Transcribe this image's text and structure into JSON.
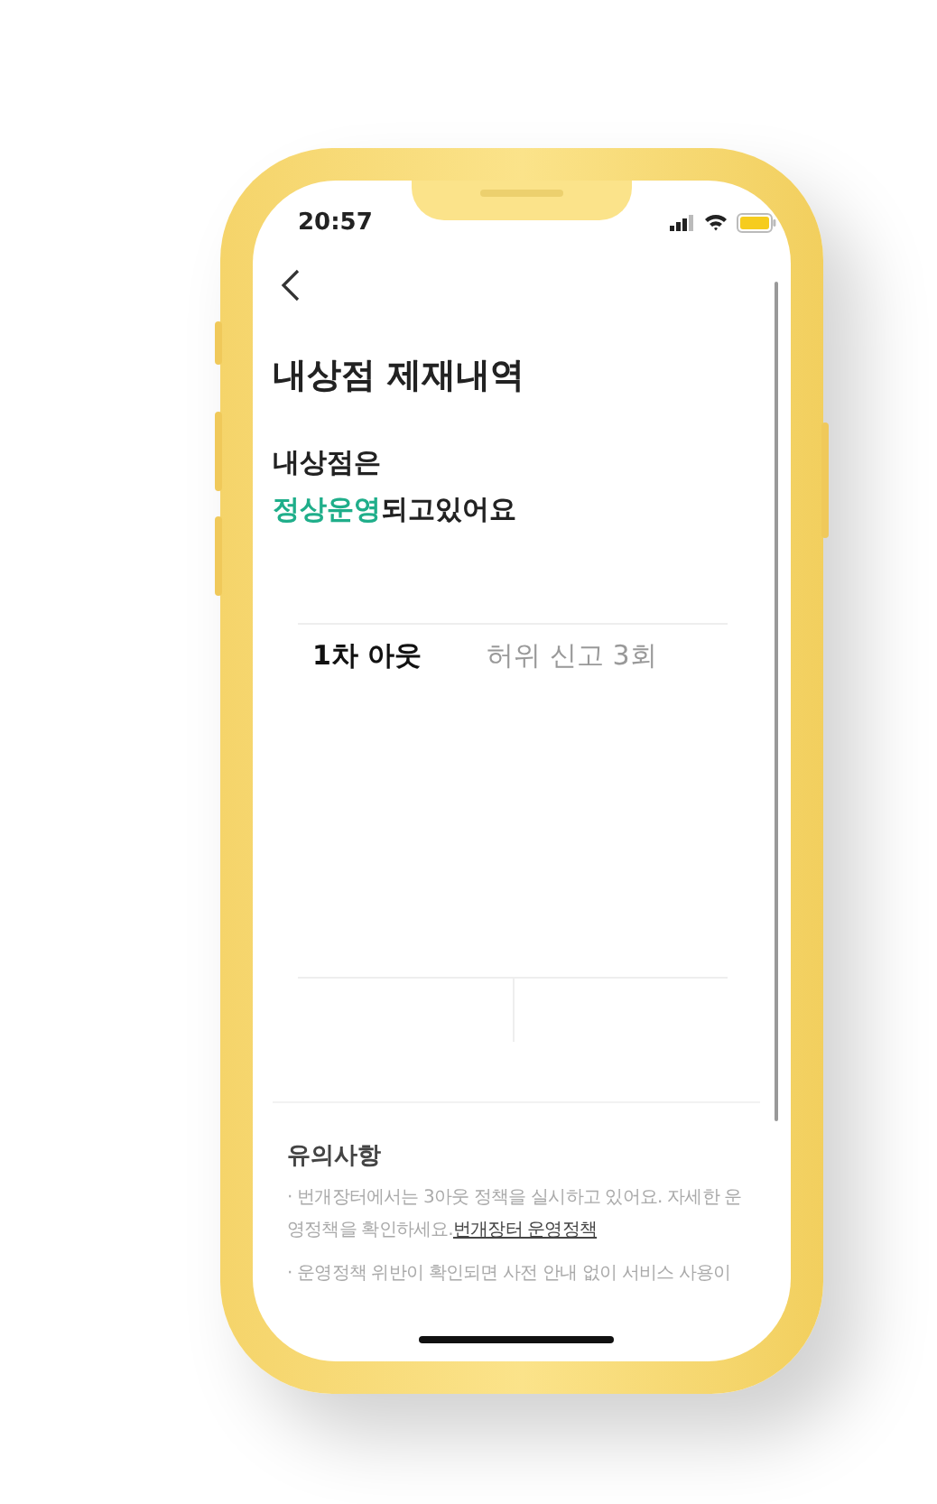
{
  "status_bar": {
    "time": "20:57"
  },
  "title": "내상점 제재내역",
  "status": {
    "line1": "내상점은",
    "highlight": "정상운영",
    "rest": "되고있어요"
  },
  "tabs": [
    {
      "label": "1차 아웃",
      "selected": true
    },
    {
      "label": "허위 신고 3회",
      "selected": false
    }
  ],
  "notice": {
    "heading": "유의사항",
    "items": [
      {
        "text": "· 번개장터에서는 3아웃 정책을 실시하고 있어요. 자세한 운영정책을 확인하세요.",
        "link": "번개장터 운영정책"
      },
      {
        "text": "· 운영정책 위반이 확인되면 사전 안내 없이 서비스 사용이"
      }
    ]
  }
}
